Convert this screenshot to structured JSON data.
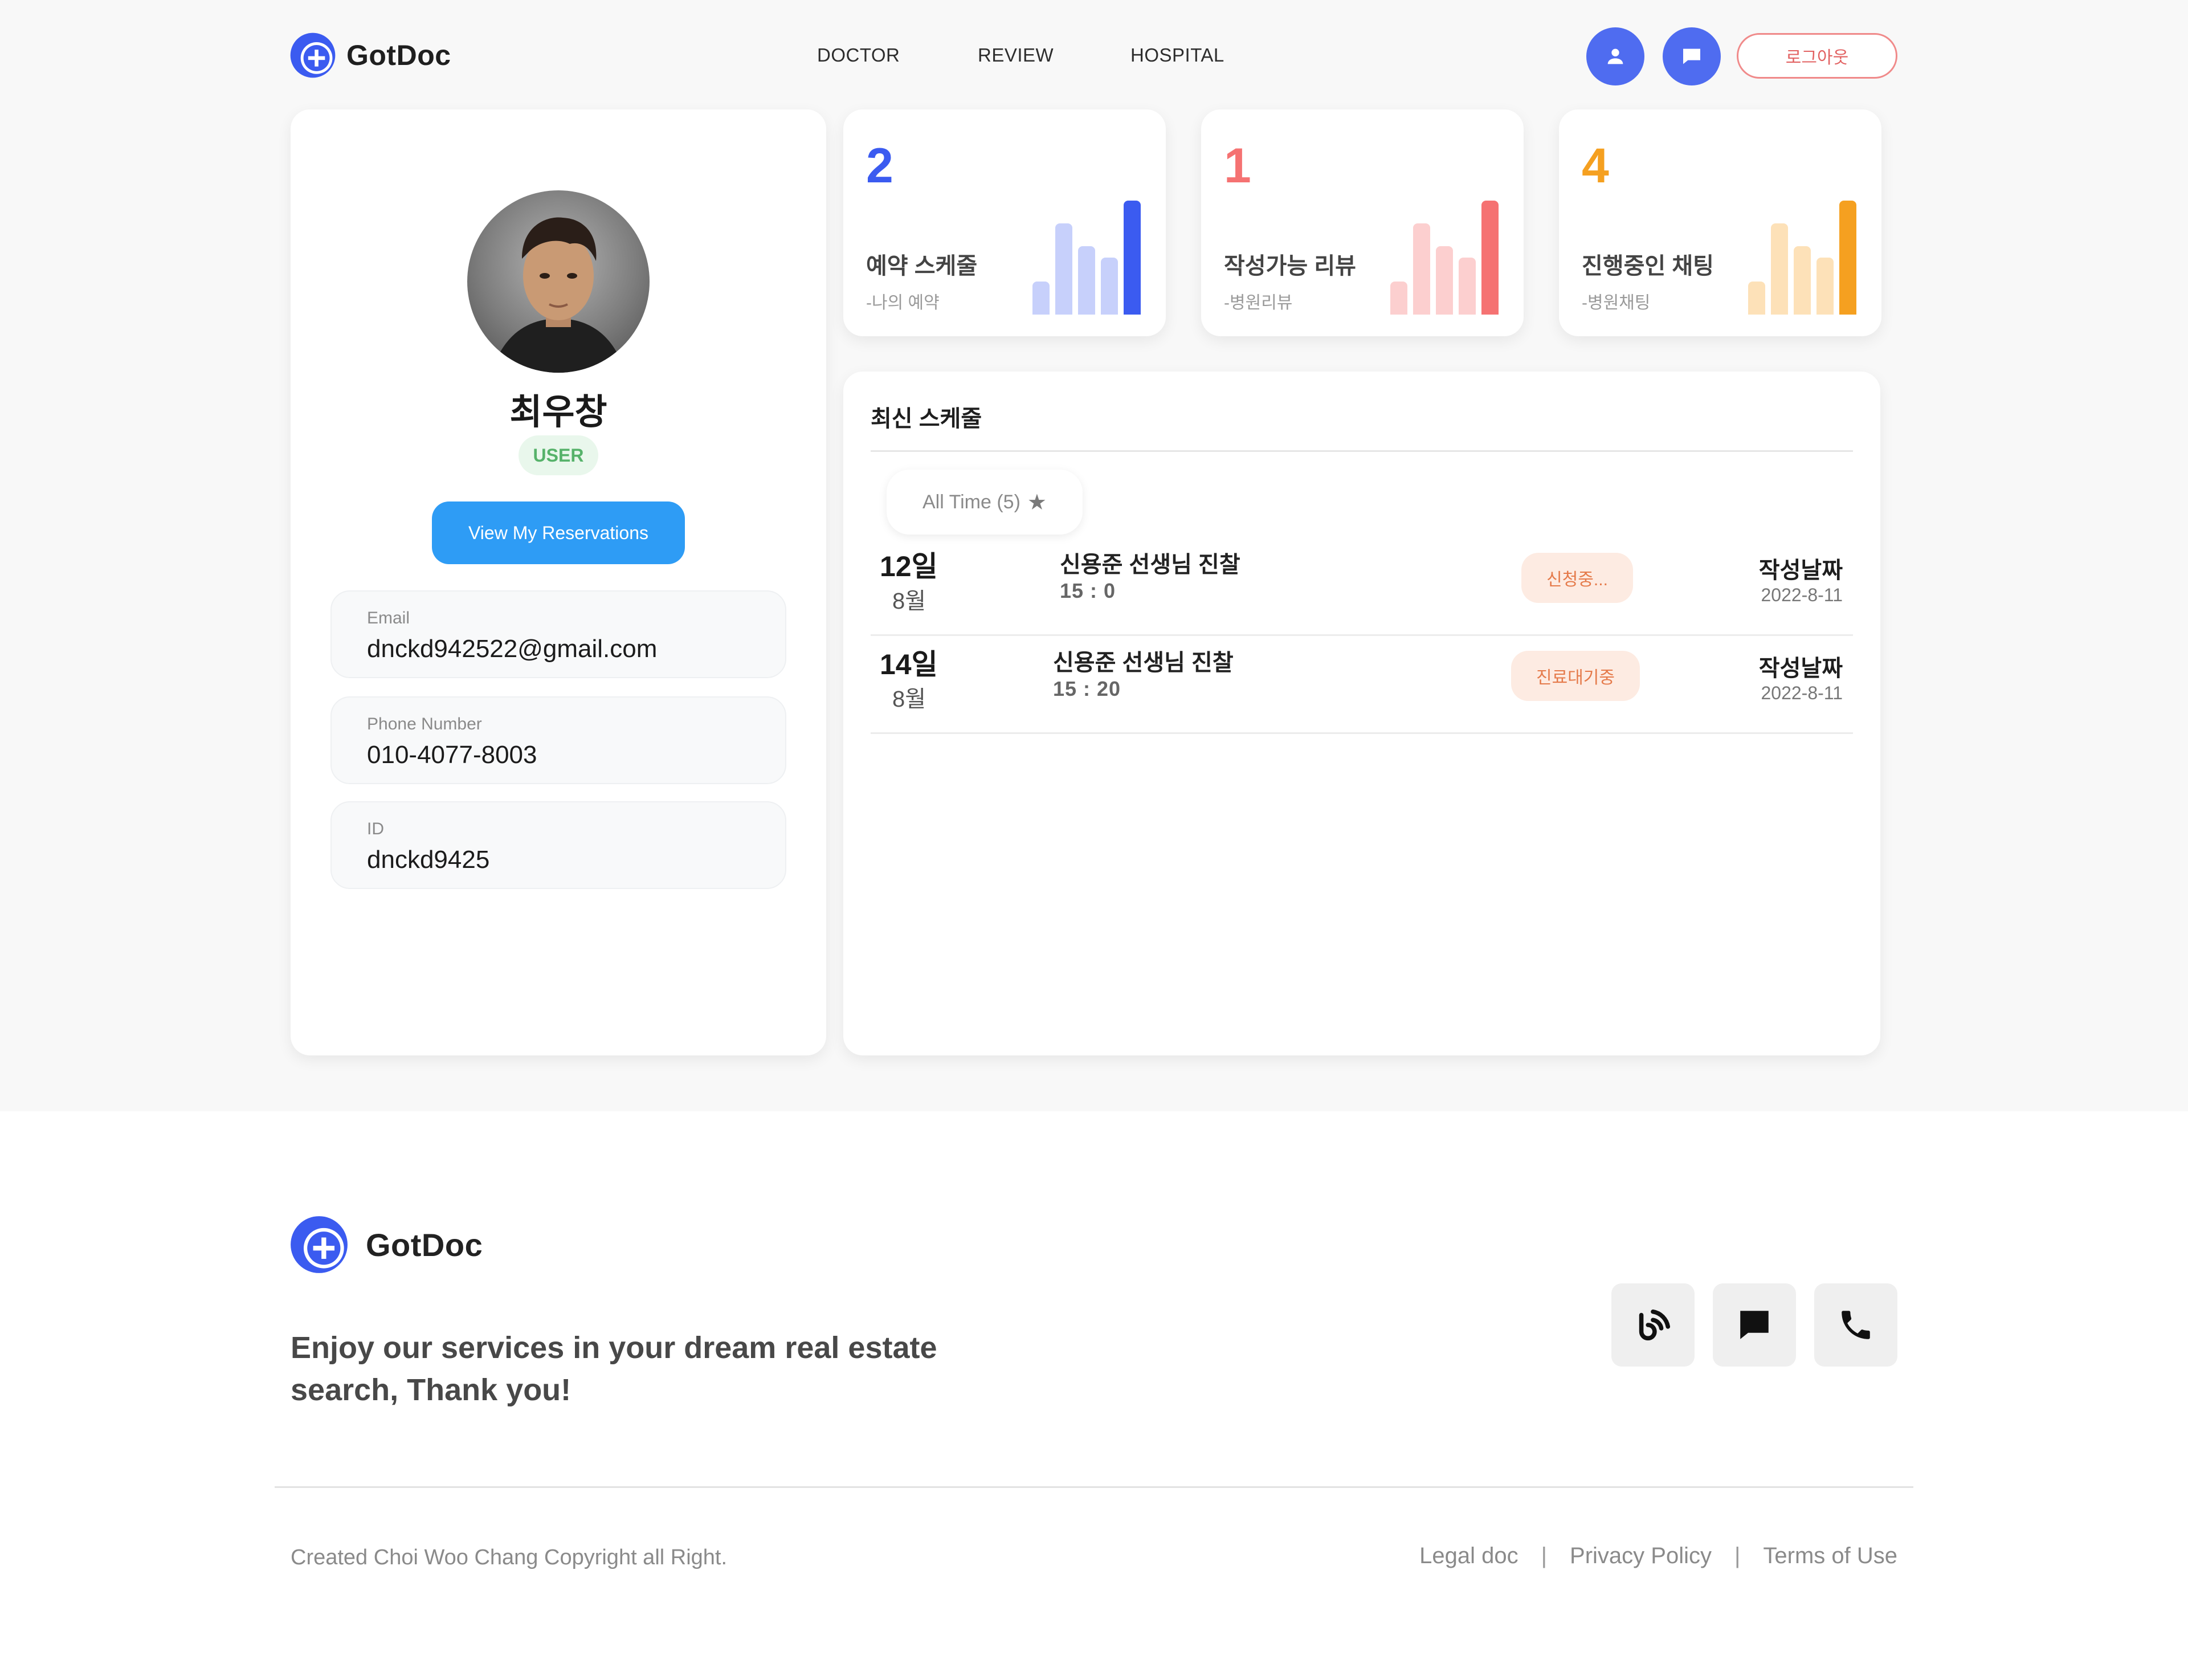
{
  "brand": {
    "name": "GotDoc",
    "color": "#3b5bf0"
  },
  "nav": {
    "items": [
      "DOCTOR",
      "REVIEW",
      "HOSPITAL"
    ]
  },
  "header": {
    "profile_icon": "user-icon",
    "chat_icon": "chat-icon",
    "logout_label": "로그아웃"
  },
  "profile": {
    "name": "최우창",
    "role": "USER",
    "reservations_button": "View My Reservations",
    "fields": [
      {
        "label": "Email",
        "value": "dnckd942522@gmail.com"
      },
      {
        "label": "Phone Number",
        "value": "010-4077-8003"
      },
      {
        "label": "ID",
        "value": "dnckd9425"
      }
    ]
  },
  "stats": [
    {
      "value": "2",
      "title": "예약 스케줄",
      "subtitle": "-나의 예약",
      "color": "#3b5bf0",
      "light_color": "#c7d0fb"
    },
    {
      "value": "1",
      "title": "작성가능 리뷰",
      "subtitle": "-병원리뷰",
      "color": "#f57272",
      "light_color": "#fccfcf"
    },
    {
      "value": "4",
      "title": "진행중인 채팅",
      "subtitle": "-병원채팅",
      "color": "#f5a020",
      "light_color": "#fde1b8"
    }
  ],
  "schedule": {
    "title": "최신 스케줄",
    "filter_label": "All Time (5)",
    "filter_icon": "star-icon",
    "rows": [
      {
        "day": "12일",
        "month": "8월",
        "doctor": "신용준 선생님 진찰",
        "time": "15 : 0",
        "status": "신청중...",
        "created_label": "작성날짜",
        "created_date": "2022-8-11"
      },
      {
        "day": "14일",
        "month": "8월",
        "doctor": "신용준 선생님 진찰",
        "time": "15 : 20",
        "status": "진료대기중",
        "created_label": "작성날짜",
        "created_date": "2022-8-11"
      }
    ]
  },
  "footer": {
    "brand": "GotDoc",
    "tagline": "Enjoy our services in your dream real estate search, Thank you!",
    "social": [
      "blog-icon",
      "chat-icon",
      "phone-icon"
    ],
    "copyright": "Created Choi Woo Chang Copyright all Right.",
    "links": [
      "Legal doc",
      "Privacy Policy",
      "Terms of Use"
    ]
  }
}
